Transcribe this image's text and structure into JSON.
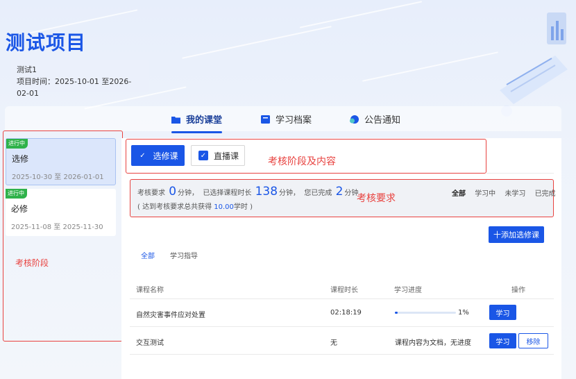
{
  "header": {
    "title": "测试项目",
    "project_name": "测试1",
    "project_time_label": "项目时间：",
    "project_time_value": "2025-10-01 至2026-02-01"
  },
  "tabs": [
    {
      "label": "我的课堂",
      "icon": "folder-icon",
      "active": true
    },
    {
      "label": "学习档案",
      "icon": "archive-icon",
      "active": false
    },
    {
      "label": "公告通知",
      "icon": "chat-bubble-icon",
      "active": false
    }
  ],
  "stages": [
    {
      "badge": "进行中",
      "name": "选修",
      "dates": "2025-10-30 至 2026-01-01",
      "selected": true
    },
    {
      "badge": "进行中",
      "name": "必修",
      "dates": "2025-11-08 至 2025-11-30",
      "selected": false
    }
  ],
  "annotations": {
    "stage": "考核阶段",
    "stage_content": "考核阶段及内容",
    "requirement": "考核要求"
  },
  "course_types": {
    "elective": "选修课",
    "live": "直播课"
  },
  "requirement": {
    "req_label": "考核要求",
    "req_value": "0",
    "minutes_1": "分钟，",
    "selected_label": "已选择课程时长",
    "selected_value": "138",
    "minutes_2": "分钟，",
    "completed_label": "您已完成",
    "completed_value": "2",
    "minutes_3": "分钟",
    "note_prefix": "( 达到考核要求总共获得",
    "note_hours": "10.00",
    "note_suffix": "学时 )"
  },
  "filters": [
    "全部",
    "学习中",
    "未学习",
    "已完成"
  ],
  "add_button": "十添加选修课",
  "sub_tabs": [
    "全部",
    "学习指导"
  ],
  "table": {
    "headers": [
      "课程名称",
      "课程时长",
      "学习进度",
      "操作"
    ],
    "rows": [
      {
        "name": "自然灾害事件应对处置",
        "duration": "02:18:19",
        "progress_text": "1%",
        "progress": 0.01,
        "actions": [
          "学习"
        ]
      },
      {
        "name": "交互测试",
        "duration": "无",
        "progress_text": "课程内容为文档，无进度",
        "progress": null,
        "actions": [
          "学习",
          "移除"
        ]
      }
    ]
  },
  "colors": {
    "accent": "#1a56e6",
    "badge": "#2fb24a",
    "annotation": "#e8423f"
  }
}
